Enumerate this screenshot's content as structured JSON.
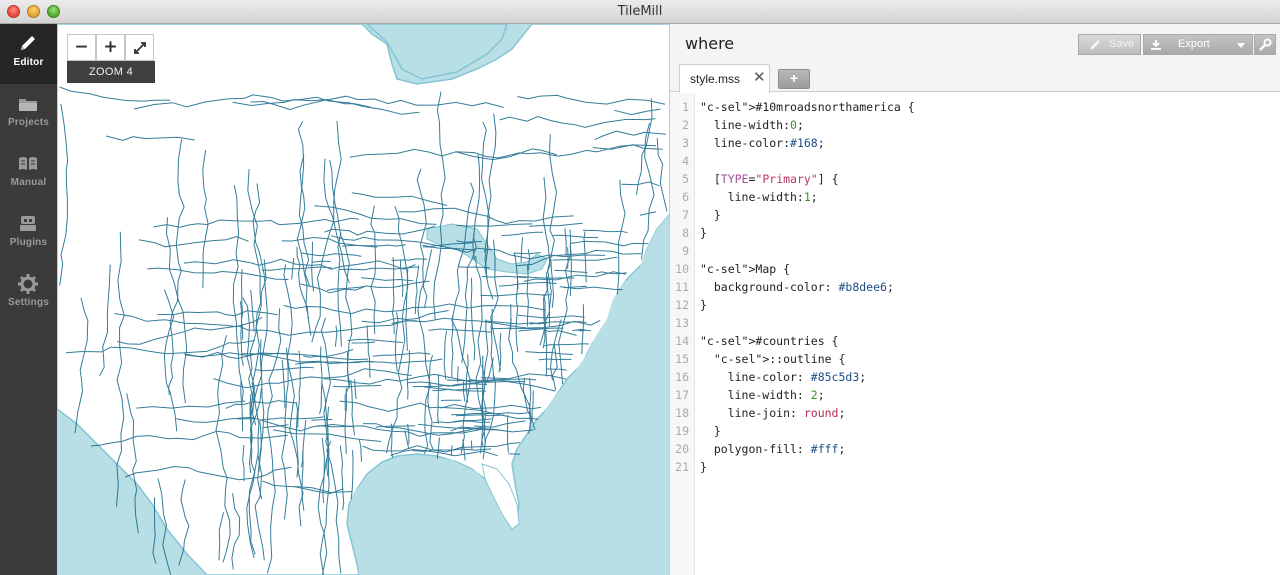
{
  "window": {
    "title": "TileMill"
  },
  "sidebar": {
    "items": [
      {
        "label": "Editor",
        "icon": "pencil-icon",
        "active": true
      },
      {
        "label": "Projects",
        "icon": "folder-icon",
        "active": false
      },
      {
        "label": "Manual",
        "icon": "book-icon",
        "active": false
      },
      {
        "label": "Plugins",
        "icon": "plugin-icon",
        "active": false
      },
      {
        "label": "Settings",
        "icon": "gear-icon",
        "active": false
      }
    ]
  },
  "map": {
    "zoom_out": "−",
    "zoom_in": "+",
    "fullscreen_icon": "expand-icon",
    "zoom_label": "ZOOM 4",
    "background_color": "#b8dee6",
    "road_color": "#168"
  },
  "editor": {
    "project_title": "where",
    "toolbar": {
      "save_label": "Save",
      "export_label": "Export"
    },
    "tab": {
      "name": "style.mss",
      "close": "✕"
    },
    "add_tab": "+",
    "code_lines": [
      "#10mroadsnorthamerica {",
      "  line-width:0;",
      "  line-color:#168;",
      "",
      "  [TYPE=\"Primary\"] {",
      "    line-width:1;",
      "  }",
      "}",
      "",
      "Map {",
      "  background-color: #b8dee6;",
      "}",
      "",
      "#countries {",
      "  ::outline {",
      "    line-color: #85c5d3;",
      "    line-width: 2;",
      "    line-join: round;",
      "  }",
      "  polygon-fill: #fff;",
      "}"
    ]
  }
}
